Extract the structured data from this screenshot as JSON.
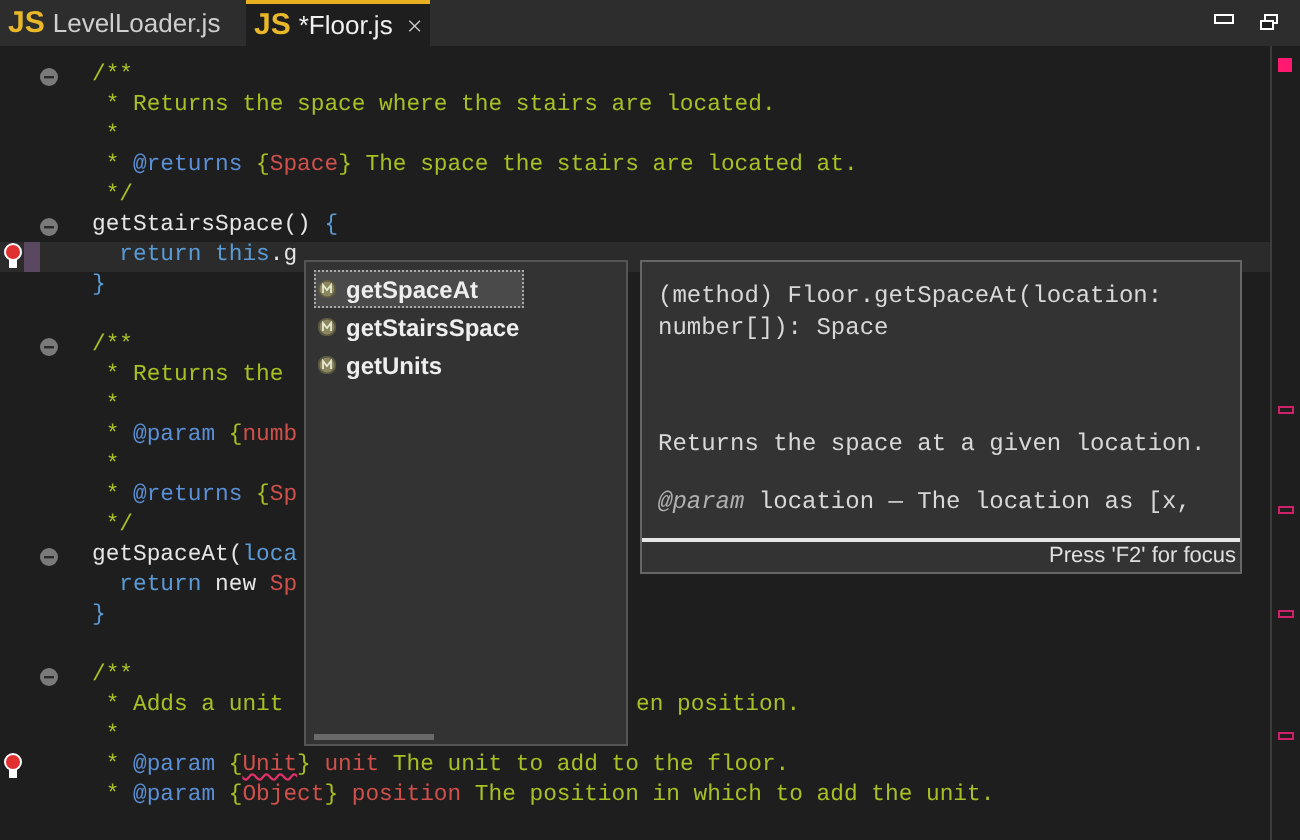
{
  "tabs": [
    {
      "icon_text": "JS",
      "label": "LevelLoader.js",
      "selected": false
    },
    {
      "icon_text": "JS",
      "label": "*Floor.js",
      "selected": true
    }
  ],
  "editor": {
    "blocks": [
      {
        "lines": [
          {
            "fold": true,
            "tokens": [
              {
                "kind": "c",
                "text": "/**"
              }
            ]
          },
          {
            "tokens": [
              {
                "kind": "c",
                "text": " * Returns the space where the stairs are located."
              }
            ]
          },
          {
            "tokens": [
              {
                "kind": "c",
                "text": " *"
              }
            ]
          },
          {
            "tokens": [
              {
                "kind": "c",
                "text": " * "
              },
              {
                "kind": "tag",
                "text": "@returns"
              },
              {
                "kind": "c",
                "text": " {"
              },
              {
                "kind": "type",
                "text": "Space"
              },
              {
                "kind": "c",
                "text": "} The space the stairs are located at."
              }
            ]
          },
          {
            "tokens": [
              {
                "kind": "c",
                "text": " */"
              }
            ]
          },
          {
            "fold": true,
            "tokens": [
              {
                "kind": "id",
                "text": "getStairsSpace() "
              },
              {
                "kind": "kw",
                "text": "{"
              }
            ]
          },
          {
            "current": true,
            "error_marker": true,
            "tokens": [
              {
                "kind": "kw",
                "text": "  return this"
              },
              {
                "kind": "id",
                "text": ".g"
              }
            ]
          },
          {
            "tokens": [
              {
                "kind": "kw",
                "text": "}"
              }
            ]
          }
        ]
      },
      {
        "lines": [
          {
            "fold": true,
            "tokens": [
              {
                "kind": "c",
                "text": "/**"
              }
            ]
          },
          {
            "tokens": [
              {
                "kind": "c",
                "text": " * Returns the"
              }
            ]
          },
          {
            "tokens": [
              {
                "kind": "c",
                "text": " *"
              }
            ]
          },
          {
            "tokens": [
              {
                "kind": "c",
                "text": " * "
              },
              {
                "kind": "tag",
                "text": "@param"
              },
              {
                "kind": "c",
                "text": " {"
              },
              {
                "kind": "type",
                "text": "numb"
              }
            ]
          },
          {
            "tokens": [
              {
                "kind": "c",
                "text": " *"
              }
            ]
          },
          {
            "tokens": [
              {
                "kind": "c",
                "text": " * "
              },
              {
                "kind": "tag",
                "text": "@returns"
              },
              {
                "kind": "c",
                "text": " {"
              },
              {
                "kind": "type",
                "text": "Sp"
              }
            ]
          },
          {
            "tokens": [
              {
                "kind": "c",
                "text": " */"
              }
            ]
          },
          {
            "fold": true,
            "tokens": [
              {
                "kind": "id",
                "text": "getSpaceAt("
              },
              {
                "kind": "kw",
                "text": "loca"
              }
            ]
          },
          {
            "tokens": [
              {
                "kind": "kw",
                "text": "  return"
              },
              {
                "kind": "id",
                "text": " new "
              },
              {
                "kind": "type",
                "text": "Sp"
              }
            ]
          },
          {
            "tokens": [
              {
                "kind": "kw",
                "text": "}"
              }
            ]
          }
        ]
      },
      {
        "lines": [
          {
            "fold": true,
            "tokens": [
              {
                "kind": "c",
                "text": "/**"
              }
            ]
          },
          {
            "tokens": [
              {
                "kind": "c",
                "text": " * Adds a unit"
              }
            ],
            "after": [
              {
                "kind": "c",
                "text": "en position."
              }
            ]
          },
          {
            "tokens": [
              {
                "kind": "c",
                "text": " *"
              }
            ]
          },
          {
            "error_marker": true,
            "tokens": [
              {
                "kind": "c",
                "text": " * "
              },
              {
                "kind": "tag",
                "text": "@param"
              },
              {
                "kind": "c",
                "text": " {"
              },
              {
                "kind": "type",
                "text": "Unit",
                "error": true
              },
              {
                "kind": "c",
                "text": "} "
              },
              {
                "kind": "type",
                "text": "unit"
              },
              {
                "kind": "c",
                "text": " The unit to add to the floor."
              }
            ]
          },
          {
            "tokens": [
              {
                "kind": "c",
                "text": " * "
              },
              {
                "kind": "tag",
                "text": "@param"
              },
              {
                "kind": "c",
                "text": " {"
              },
              {
                "kind": "type",
                "text": "Object"
              },
              {
                "kind": "c",
                "text": "} "
              },
              {
                "kind": "type",
                "text": "position"
              },
              {
                "kind": "c",
                "text": " The position in which to add the unit."
              }
            ]
          }
        ]
      }
    ]
  },
  "completion": {
    "items": [
      {
        "label": "getSpaceAt",
        "selected": true
      },
      {
        "label": "getStairsSpace",
        "selected": false
      },
      {
        "label": "getUnits",
        "selected": false
      }
    ]
  },
  "doc_popup": {
    "signature_lines": [
      "(method) Floor.getSpaceAt(location:",
      "number[]): Space"
    ],
    "description": "Returns the space at a given location.",
    "param_tag": "@param",
    "param_text": " location — The location as [x,",
    "footer": "Press 'F2' for focus"
  }
}
